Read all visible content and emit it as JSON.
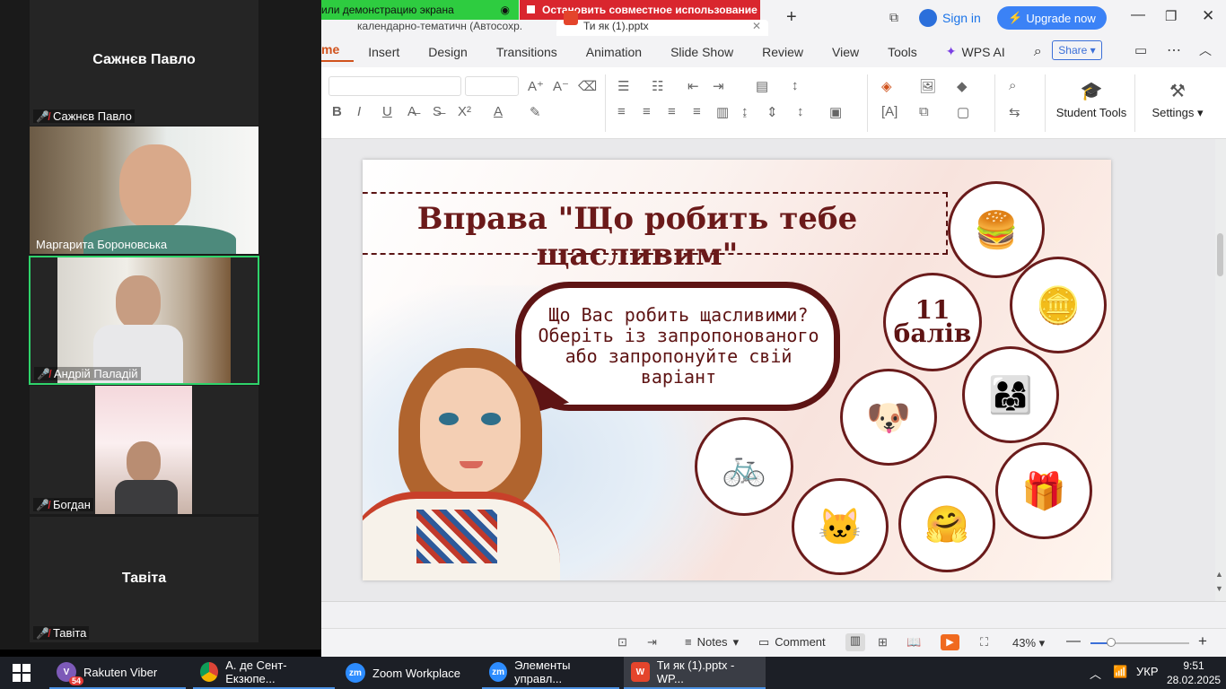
{
  "zoom": {
    "participants": [
      {
        "name": "Сажнєв Павло",
        "big_name": "Сажнєв Павло"
      },
      {
        "name": "Маргарита Бороновська"
      },
      {
        "name": "Андрій Паладій"
      },
      {
        "name": "Богдан"
      },
      {
        "name": "Тавіта",
        "big_name": "Тавіта"
      }
    ],
    "share_banner": {
      "status": "или демонстрацию экрана",
      "stop_label": "Остановить совместное использование"
    }
  },
  "wps": {
    "doc_tab_1": "календарно-тематичн (Автосохр.",
    "doc_tab_2": "Ти як (1).pptx",
    "sign_in": "Sign in",
    "upgrade": "Upgrade now",
    "tabs": [
      "me",
      "Insert",
      "Design",
      "Transitions",
      "Animation",
      "Slide Show",
      "Review",
      "View",
      "Tools"
    ],
    "wps_ai": "WPS AI",
    "share": "Share",
    "student_tools": "Student Tools",
    "settings": "Settings"
  },
  "slide": {
    "title": "Вправа \"Що робить тебе щасливим\"",
    "bubble_text": "Що Вас робить щасливими? Оберіть із запропонованого або запропонуйте свій варіант",
    "score_number": "11",
    "score_unit": "балів"
  },
  "statusbar": {
    "notes": "Notes",
    "comment": "Comment",
    "zoom": "43%"
  },
  "taskbar": {
    "viber": "Rakuten Viber",
    "viber_badge": "54",
    "chrome": "А. де Сент-Екзюпе...",
    "zoom_app": "Zoom Workplace",
    "zoom_controls": "Элементы управл...",
    "wps": "Ти як (1).pptx - WP...",
    "lang": "УКР",
    "time": "9:51",
    "date": "28.02.2025"
  }
}
